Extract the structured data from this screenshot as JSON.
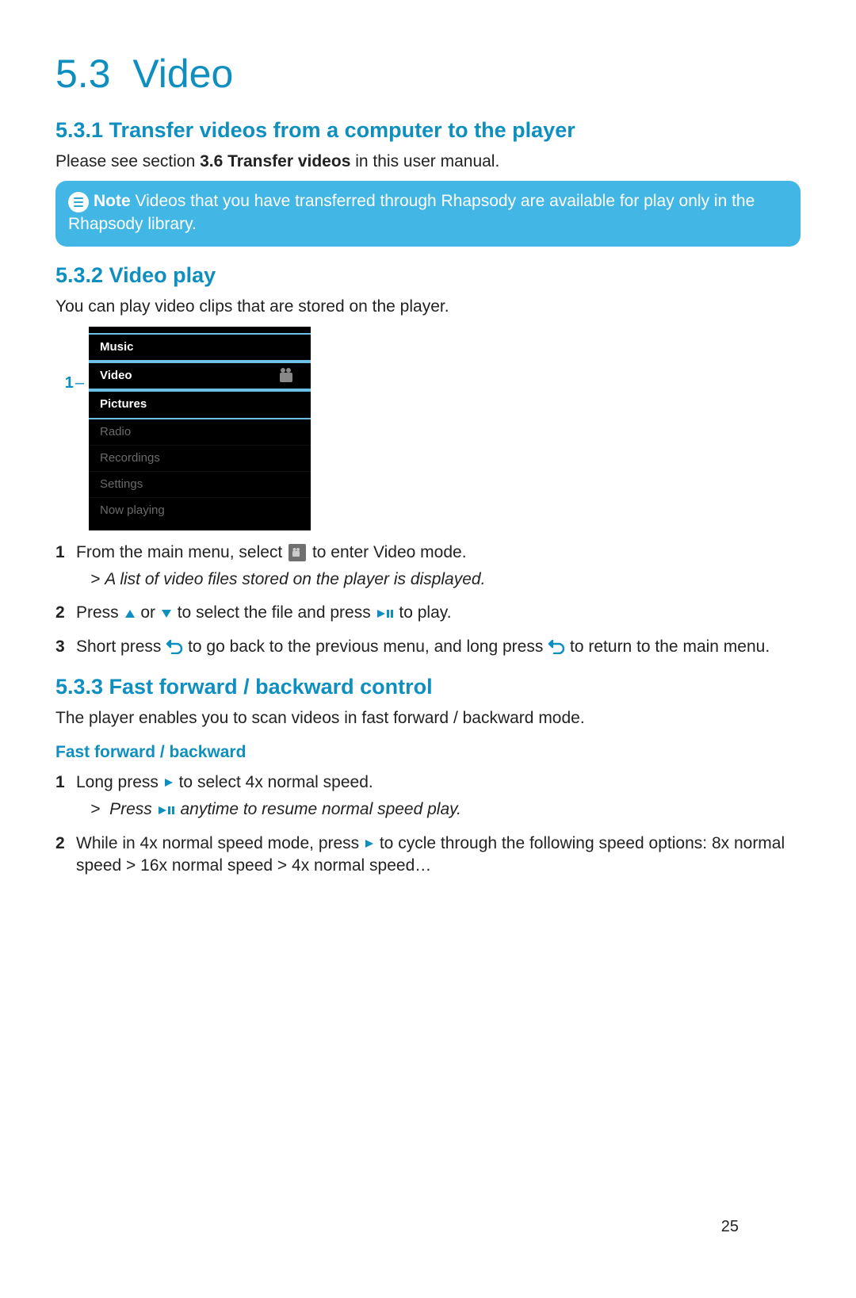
{
  "section": {
    "number": "5.3",
    "title": "Video"
  },
  "sub1": {
    "heading": "5.3.1 Transfer videos from a computer to the player",
    "text_pre": "Please see section ",
    "text_bold": "3.6 Transfer videos",
    "text_post": " in this user manual."
  },
  "note": {
    "label": "Note",
    "text": " Videos that you have transferred through Rhapsody are available for play only in the Rhapsody library."
  },
  "sub2": {
    "heading": "5.3.2 Video play",
    "intro": "You can play video clips that are stored on the player.",
    "callout": "1",
    "menu": {
      "items": [
        "Music",
        "Video",
        "Pictures",
        "Radio",
        "Recordings",
        "Settings",
        "Now playing"
      ],
      "highlight_index": 1
    },
    "steps": [
      {
        "n": "1",
        "t1": "From the main menu, select ",
        "t2": " to enter Video mode.",
        "result": "A list of video files stored on the player is displayed."
      },
      {
        "n": "2",
        "t1": "Press ",
        "t2": " or ",
        "t3": " to select the file and press ",
        "t4": " to play."
      },
      {
        "n": "3",
        "t1": "Short press ",
        "t2": " to go back to the previous menu, and long press ",
        "t3": " to return to the main menu."
      }
    ]
  },
  "sub3": {
    "heading": "5.3.3 Fast forward / backward control",
    "intro": "The player enables you to scan videos in fast forward / backward mode.",
    "subhead": "Fast forward / backward",
    "steps": [
      {
        "n": "1",
        "t1": "Long press ",
        "t2": " to select 4x normal speed.",
        "result_pre": "Press ",
        "result_post": " anytime to resume normal speed play."
      },
      {
        "n": "2",
        "t1": "While in 4x normal speed mode, press ",
        "t2": " to cycle through the following speed options: 8x normal speed > 16x normal speed > 4x normal speed…"
      }
    ]
  },
  "page_number": "25"
}
